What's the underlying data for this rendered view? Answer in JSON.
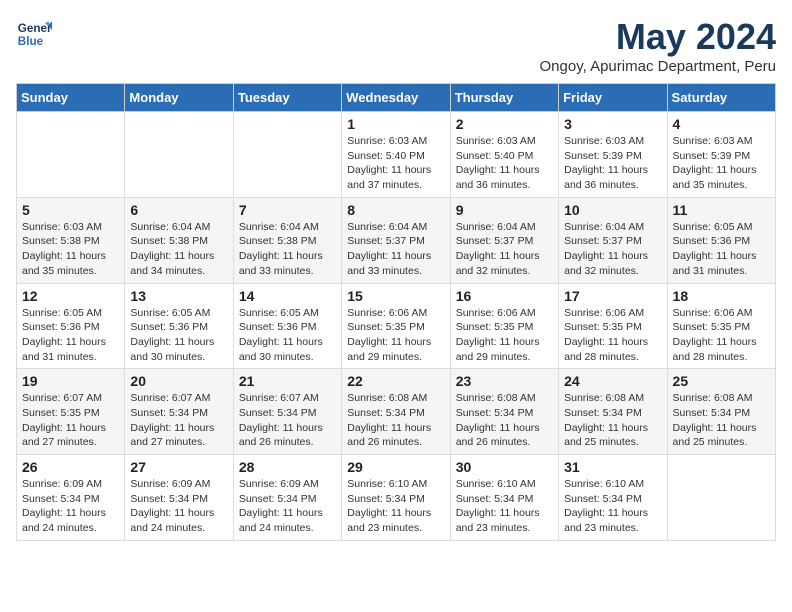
{
  "logo": {
    "line1": "General",
    "line2": "Blue"
  },
  "title": "May 2024",
  "subtitle": "Ongoy, Apurimac Department, Peru",
  "weekdays": [
    "Sunday",
    "Monday",
    "Tuesday",
    "Wednesday",
    "Thursday",
    "Friday",
    "Saturday"
  ],
  "weeks": [
    [
      {
        "day": "",
        "info": ""
      },
      {
        "day": "",
        "info": ""
      },
      {
        "day": "",
        "info": ""
      },
      {
        "day": "1",
        "info": "Sunrise: 6:03 AM\nSunset: 5:40 PM\nDaylight: 11 hours\nand 37 minutes."
      },
      {
        "day": "2",
        "info": "Sunrise: 6:03 AM\nSunset: 5:40 PM\nDaylight: 11 hours\nand 36 minutes."
      },
      {
        "day": "3",
        "info": "Sunrise: 6:03 AM\nSunset: 5:39 PM\nDaylight: 11 hours\nand 36 minutes."
      },
      {
        "day": "4",
        "info": "Sunrise: 6:03 AM\nSunset: 5:39 PM\nDaylight: 11 hours\nand 35 minutes."
      }
    ],
    [
      {
        "day": "5",
        "info": "Sunrise: 6:03 AM\nSunset: 5:38 PM\nDaylight: 11 hours\nand 35 minutes."
      },
      {
        "day": "6",
        "info": "Sunrise: 6:04 AM\nSunset: 5:38 PM\nDaylight: 11 hours\nand 34 minutes."
      },
      {
        "day": "7",
        "info": "Sunrise: 6:04 AM\nSunset: 5:38 PM\nDaylight: 11 hours\nand 33 minutes."
      },
      {
        "day": "8",
        "info": "Sunrise: 6:04 AM\nSunset: 5:37 PM\nDaylight: 11 hours\nand 33 minutes."
      },
      {
        "day": "9",
        "info": "Sunrise: 6:04 AM\nSunset: 5:37 PM\nDaylight: 11 hours\nand 32 minutes."
      },
      {
        "day": "10",
        "info": "Sunrise: 6:04 AM\nSunset: 5:37 PM\nDaylight: 11 hours\nand 32 minutes."
      },
      {
        "day": "11",
        "info": "Sunrise: 6:05 AM\nSunset: 5:36 PM\nDaylight: 11 hours\nand 31 minutes."
      }
    ],
    [
      {
        "day": "12",
        "info": "Sunrise: 6:05 AM\nSunset: 5:36 PM\nDaylight: 11 hours\nand 31 minutes."
      },
      {
        "day": "13",
        "info": "Sunrise: 6:05 AM\nSunset: 5:36 PM\nDaylight: 11 hours\nand 30 minutes."
      },
      {
        "day": "14",
        "info": "Sunrise: 6:05 AM\nSunset: 5:36 PM\nDaylight: 11 hours\nand 30 minutes."
      },
      {
        "day": "15",
        "info": "Sunrise: 6:06 AM\nSunset: 5:35 PM\nDaylight: 11 hours\nand 29 minutes."
      },
      {
        "day": "16",
        "info": "Sunrise: 6:06 AM\nSunset: 5:35 PM\nDaylight: 11 hours\nand 29 minutes."
      },
      {
        "day": "17",
        "info": "Sunrise: 6:06 AM\nSunset: 5:35 PM\nDaylight: 11 hours\nand 28 minutes."
      },
      {
        "day": "18",
        "info": "Sunrise: 6:06 AM\nSunset: 5:35 PM\nDaylight: 11 hours\nand 28 minutes."
      }
    ],
    [
      {
        "day": "19",
        "info": "Sunrise: 6:07 AM\nSunset: 5:35 PM\nDaylight: 11 hours\nand 27 minutes."
      },
      {
        "day": "20",
        "info": "Sunrise: 6:07 AM\nSunset: 5:34 PM\nDaylight: 11 hours\nand 27 minutes."
      },
      {
        "day": "21",
        "info": "Sunrise: 6:07 AM\nSunset: 5:34 PM\nDaylight: 11 hours\nand 26 minutes."
      },
      {
        "day": "22",
        "info": "Sunrise: 6:08 AM\nSunset: 5:34 PM\nDaylight: 11 hours\nand 26 minutes."
      },
      {
        "day": "23",
        "info": "Sunrise: 6:08 AM\nSunset: 5:34 PM\nDaylight: 11 hours\nand 26 minutes."
      },
      {
        "day": "24",
        "info": "Sunrise: 6:08 AM\nSunset: 5:34 PM\nDaylight: 11 hours\nand 25 minutes."
      },
      {
        "day": "25",
        "info": "Sunrise: 6:08 AM\nSunset: 5:34 PM\nDaylight: 11 hours\nand 25 minutes."
      }
    ],
    [
      {
        "day": "26",
        "info": "Sunrise: 6:09 AM\nSunset: 5:34 PM\nDaylight: 11 hours\nand 24 minutes."
      },
      {
        "day": "27",
        "info": "Sunrise: 6:09 AM\nSunset: 5:34 PM\nDaylight: 11 hours\nand 24 minutes."
      },
      {
        "day": "28",
        "info": "Sunrise: 6:09 AM\nSunset: 5:34 PM\nDaylight: 11 hours\nand 24 minutes."
      },
      {
        "day": "29",
        "info": "Sunrise: 6:10 AM\nSunset: 5:34 PM\nDaylight: 11 hours\nand 23 minutes."
      },
      {
        "day": "30",
        "info": "Sunrise: 6:10 AM\nSunset: 5:34 PM\nDaylight: 11 hours\nand 23 minutes."
      },
      {
        "day": "31",
        "info": "Sunrise: 6:10 AM\nSunset: 5:34 PM\nDaylight: 11 hours\nand 23 minutes."
      },
      {
        "day": "",
        "info": ""
      }
    ]
  ]
}
